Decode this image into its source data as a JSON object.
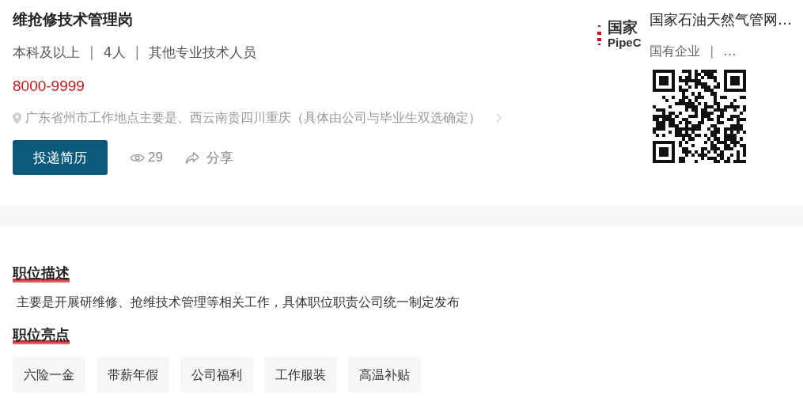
{
  "job": {
    "title": "维抢修技术管理岗",
    "meta": [
      "本科及以上",
      "4人",
      "其他专业技术人员"
    ],
    "separator": "|",
    "salary": "8000-9999",
    "location": "广东省州市工作地点主要是、西云南贵四川重庆（具体由公司与毕业生双选确定）",
    "apply_button": "投递简历",
    "views": "29",
    "share": "分享"
  },
  "company": {
    "logo": {
      "line_1": "国家",
      "line_2": "PipeC"
    },
    "name": "国家石油天然气管网…",
    "meta": [
      "国有企业",
      "…"
    ],
    "separator": "|"
  },
  "sections": [
    {
      "title": "职位描述",
      "kind": "text",
      "text": "主要是开展研维修、抢维技术管理等相关工作，具体职位职责公司统一制定发布"
    },
    {
      "title": "职位亮点",
      "kind": "tags",
      "tags": [
        "六险一金",
        "带薪年假",
        "公司福利",
        "工作服装",
        "高温补贴"
      ]
    }
  ]
}
